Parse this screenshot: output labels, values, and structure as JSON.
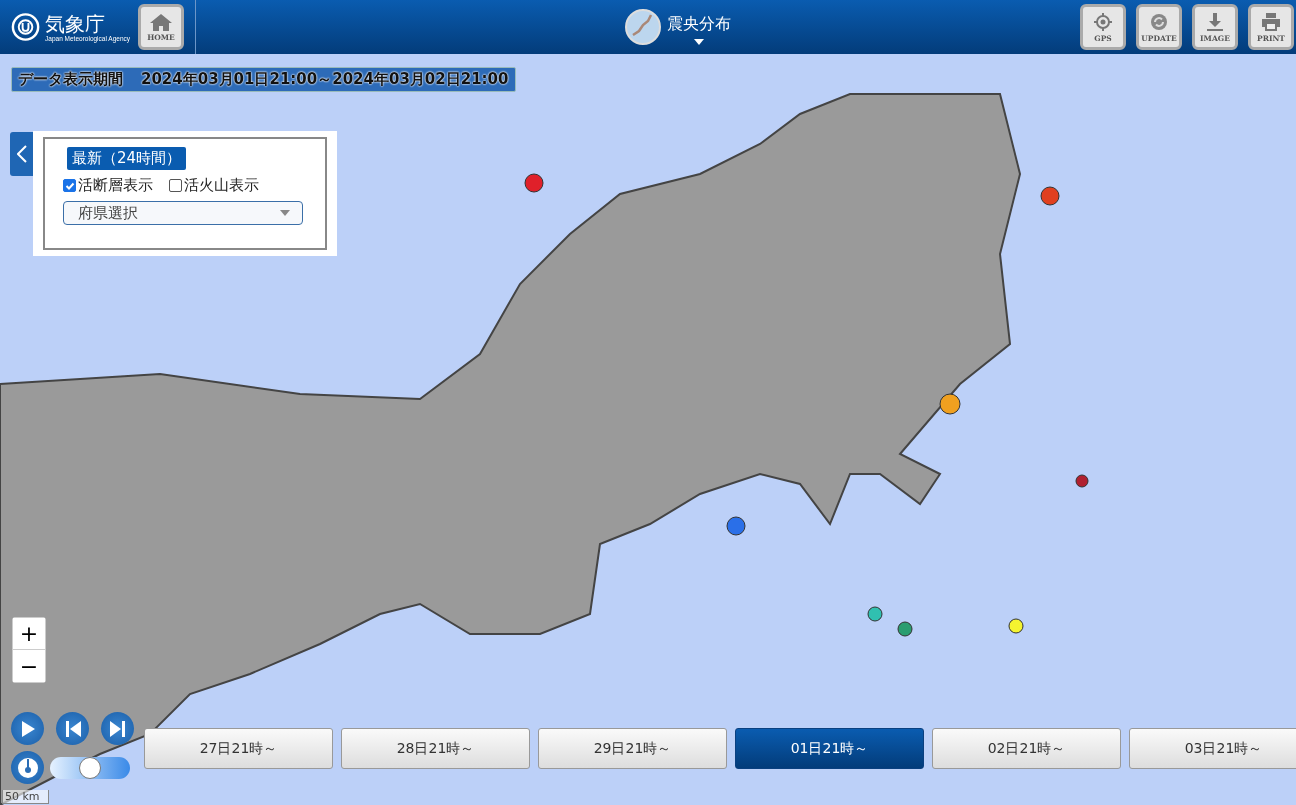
{
  "header": {
    "logo_text": "気象庁",
    "logo_subtext": "Japan Meteorological Agency",
    "home_button": "HOME",
    "title": "震央分布",
    "tools": [
      {
        "kind": "gps",
        "label": "GPS"
      },
      {
        "kind": "update",
        "label": "UPDATE"
      },
      {
        "kind": "image",
        "label": "IMAGE"
      },
      {
        "kind": "print",
        "label": "PRINT"
      }
    ]
  },
  "period": {
    "label": "データ表示期間",
    "value": "2024年03月01日21:00～2024年03月02日21:00"
  },
  "panel": {
    "range_button": "最新（24時間）",
    "options": [
      {
        "label": "活断層表示",
        "checked": true
      },
      {
        "label": "活火山表示",
        "checked": false
      }
    ],
    "prefecture_select": {
      "placeholder": "府県選択"
    }
  },
  "zoom": {
    "in": "+",
    "out": "−"
  },
  "opacity_slider": {
    "level": 0.5
  },
  "scale": "50 km",
  "days": [
    {
      "label": "27日21時～",
      "selected": false
    },
    {
      "label": "28日21時～",
      "selected": false
    },
    {
      "label": "29日21時～",
      "selected": false
    },
    {
      "label": "01日21時～",
      "selected": true
    },
    {
      "label": "02日21時～",
      "selected": false
    },
    {
      "label": "03日21時～",
      "selected": false
    }
  ]
}
